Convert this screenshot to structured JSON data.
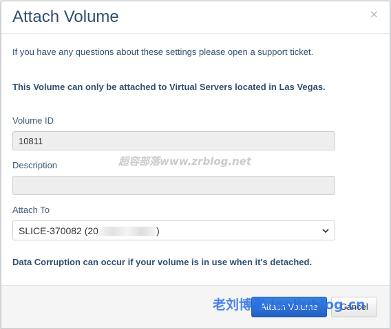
{
  "modal": {
    "title": "Attach Volume",
    "close_glyph": "×",
    "info_text": "If you have any questions about these settings please open a support ticket.",
    "location_warning": "This Volume can only be attached to Virtual Servers located in Las Vegas.",
    "fields": {
      "volume_id": {
        "label": "Volume ID",
        "value": "10811"
      },
      "description": {
        "label": "Description",
        "value": ""
      },
      "attach_to": {
        "label": "Attach To",
        "selected_prefix": "SLICE-370082 (20",
        "selected_suffix": ")"
      }
    },
    "corruption_warning": "Data Corruption can occur if your volume is in use when it's detached.",
    "footer": {
      "attach_label": "Attach Volume",
      "cancel_label": "Cancel"
    }
  },
  "watermarks": {
    "overlay_1": "超容部落www.zrblog.net",
    "overlay_2": "老刘博客-laoliublog.cn"
  },
  "colors": {
    "title": "#2f4f6f",
    "primary_button": "#2a6fd6",
    "readonly_input_bg": "#eeeeee",
    "footer_bg": "#f5f5f5"
  }
}
